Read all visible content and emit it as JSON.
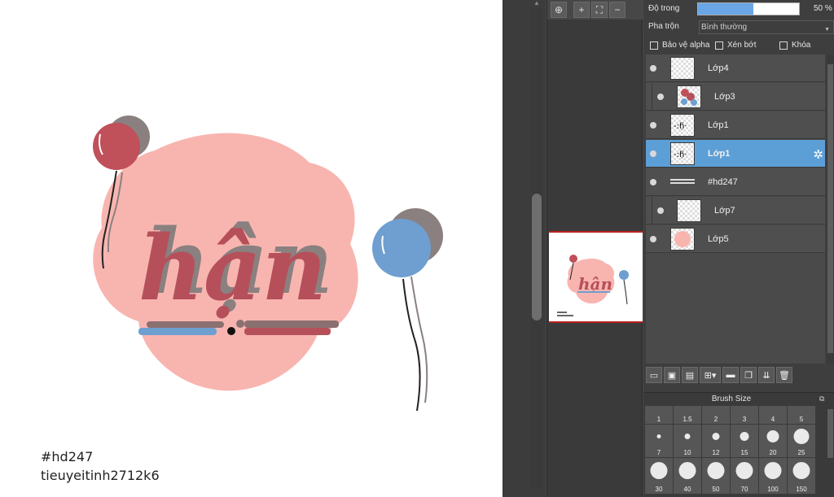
{
  "canvas": {
    "watermark_line1": "#hd247",
    "watermark_line2": "tieuyeitinh2712k6",
    "artwork_text": "hận"
  },
  "navigator": {
    "buttons": [
      "zoom-fit-icon",
      "zoom-in-icon",
      "fit-window-icon",
      "zoom-out-icon"
    ]
  },
  "properties": {
    "opacity_label": "Độ trong",
    "opacity_value": "50 %",
    "opacity_fraction": 0.55,
    "blend_label": "Pha trộn",
    "blend_value": "Bình thường",
    "protect_alpha_label": "Bảo vệ alpha",
    "clipping_label": "Xén bớt",
    "lock_label": "Khóa"
  },
  "layers": [
    {
      "name": "Lớp4",
      "indented": false,
      "selected": false
    },
    {
      "name": "Lớp3",
      "indented": true,
      "selected": false
    },
    {
      "name": "Lớp1",
      "indented": false,
      "selected": false
    },
    {
      "name": "Lớp1",
      "indented": false,
      "selected": true
    },
    {
      "name": "#hd247",
      "indented": false,
      "selected": false
    },
    {
      "name": "Lớp7",
      "indented": true,
      "selected": false
    },
    {
      "name": "Lớp5",
      "indented": false,
      "selected": false
    }
  ],
  "brush": {
    "title": "Brush Size",
    "sizes": [
      "1",
      "1.5",
      "2",
      "3",
      "4",
      "5",
      "7",
      "10",
      "12",
      "15",
      "20",
      "25",
      "30",
      "40",
      "50",
      "70",
      "100",
      "150"
    ]
  },
  "colors": {
    "blob_pink": "#f8b5b0",
    "text_red": "#b5505a",
    "shadow_gray": "#8a8080",
    "balloon_red": "#c0505a",
    "balloon_blue": "#6e9fd0",
    "selected_layer": "#5c9fd6"
  }
}
